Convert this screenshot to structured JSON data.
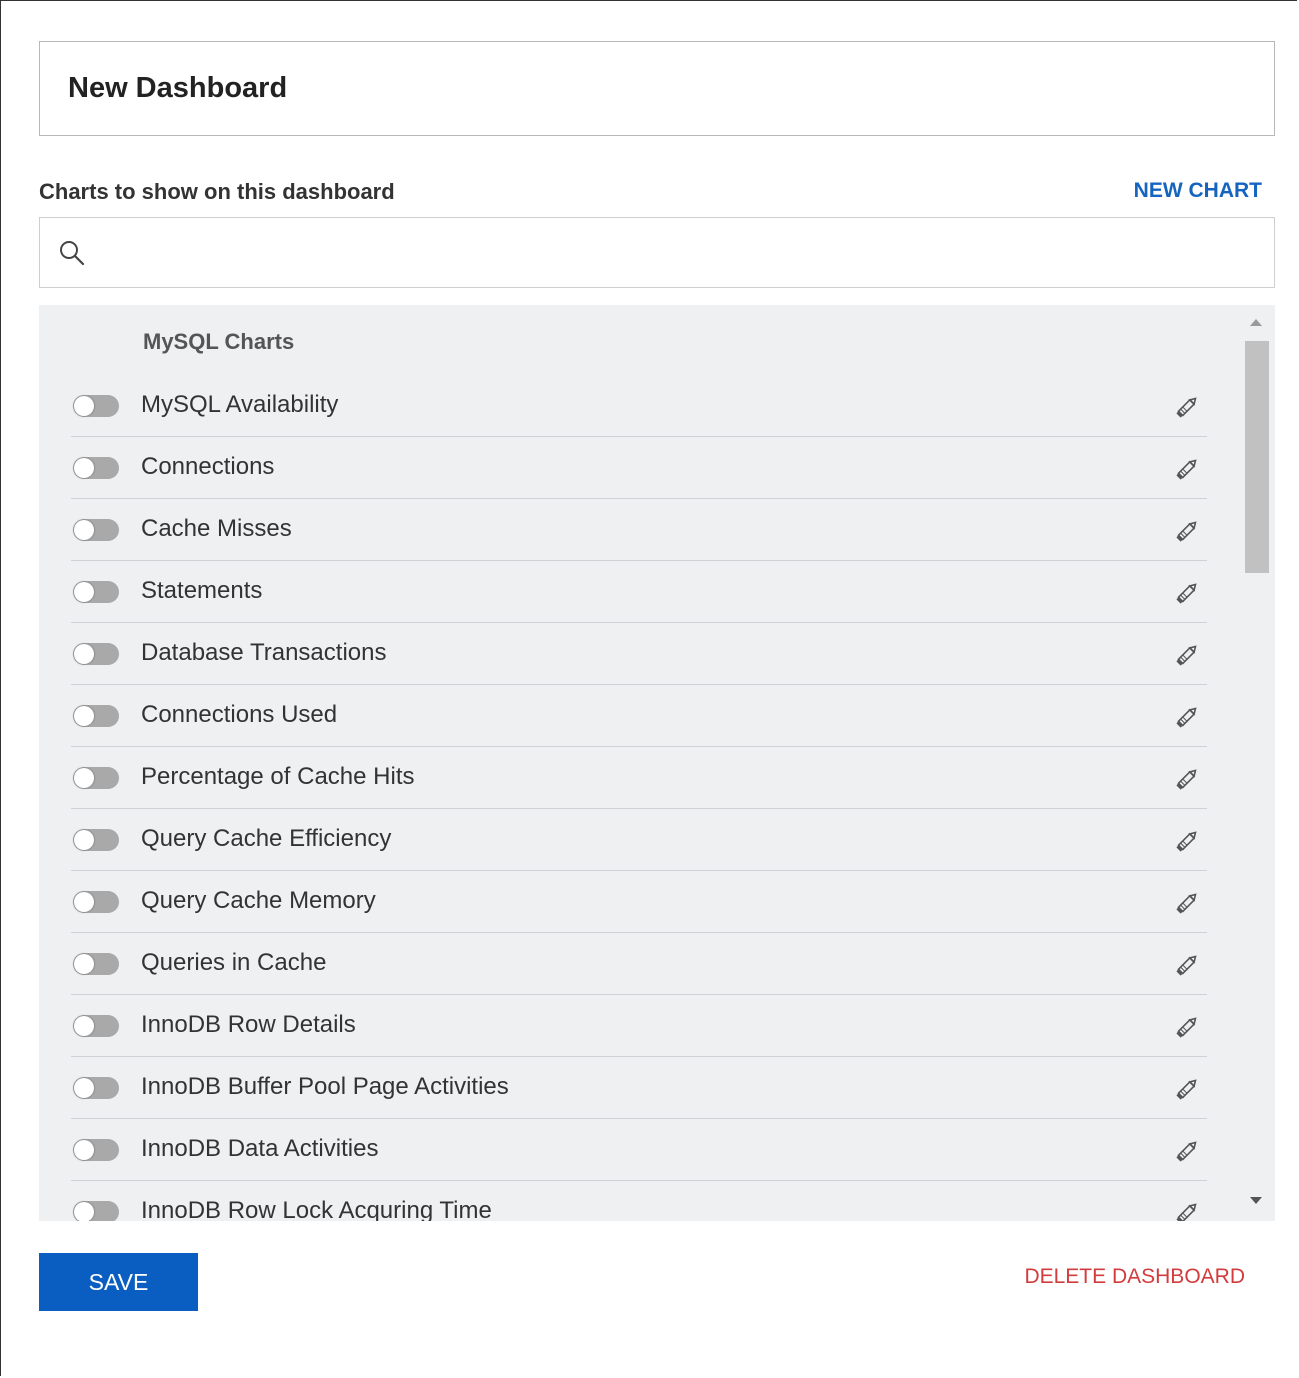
{
  "dashboard": {
    "title": "New Dashboard"
  },
  "charts_section": {
    "label": "Charts to show on this dashboard",
    "new_chart_label": "NEW CHART",
    "search_placeholder": "",
    "search_value": ""
  },
  "chart_list": {
    "group_title": "MySQL Charts",
    "items": [
      {
        "label": "MySQL Availability",
        "enabled": false
      },
      {
        "label": "Connections",
        "enabled": false
      },
      {
        "label": "Cache Misses",
        "enabled": false
      },
      {
        "label": "Statements",
        "enabled": false
      },
      {
        "label": "Database Transactions",
        "enabled": false
      },
      {
        "label": "Connections Used",
        "enabled": false
      },
      {
        "label": "Percentage of Cache Hits",
        "enabled": false
      },
      {
        "label": "Query Cache Efficiency",
        "enabled": false
      },
      {
        "label": "Query Cache Memory",
        "enabled": false
      },
      {
        "label": "Queries in Cache",
        "enabled": false
      },
      {
        "label": "InnoDB Row Details",
        "enabled": false
      },
      {
        "label": "InnoDB Buffer Pool Page Activities",
        "enabled": false
      },
      {
        "label": "InnoDB Data Activities",
        "enabled": false
      },
      {
        "label": "InnoDB Row Lock Acquring Time",
        "enabled": false
      }
    ]
  },
  "footer": {
    "save_label": "SAVE",
    "delete_label": "DELETE DASHBOARD"
  },
  "colors": {
    "accent": "#1565c0",
    "primary_button": "#0a5ec2",
    "danger": "#d23c3c",
    "toggle_off": "#a9a9a9",
    "list_background": "#eef0f2"
  },
  "icons": {
    "search": "search-icon",
    "edit": "pencil-icon",
    "toggle": "toggle-switch"
  }
}
